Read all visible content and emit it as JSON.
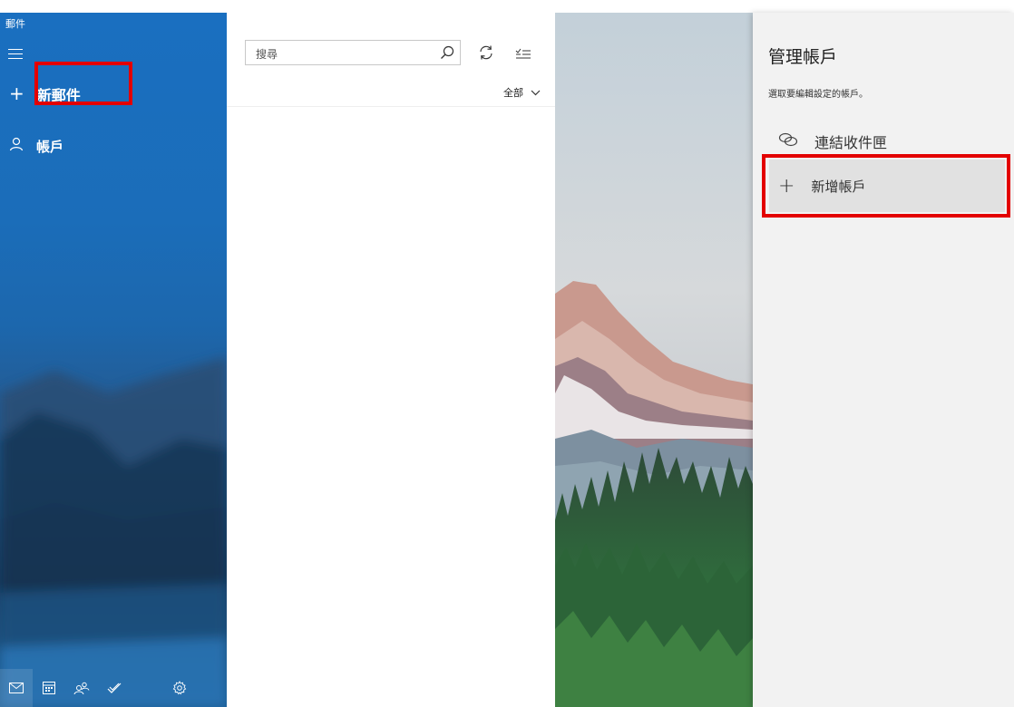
{
  "app": {
    "title": "郵件"
  },
  "sidebar": {
    "new_mail_label": "新郵件",
    "accounts_label": "帳戶",
    "bottom_icons": [
      "mail-icon",
      "calendar-icon",
      "people-icon",
      "todo-icon",
      "settings-icon"
    ]
  },
  "message_list": {
    "search_placeholder": "搜尋",
    "filter_label": "全部"
  },
  "window_controls": {
    "minimize": "–",
    "maximize": "☐",
    "close": "✕"
  },
  "manage_accounts": {
    "title": "管理帳戶",
    "subtitle": "選取要編輯設定的帳戶。",
    "link_inboxes_label": "連結收件匣",
    "add_account_label": "新增帳戶"
  },
  "colors": {
    "sidebar_blue": "#1a6fc0",
    "highlight_red": "#e30000",
    "panel_bg": "#f2f2f2"
  }
}
